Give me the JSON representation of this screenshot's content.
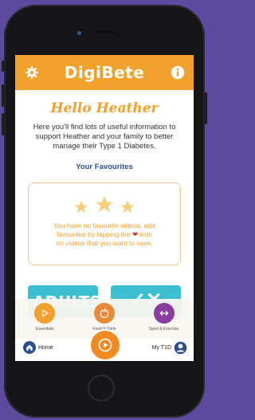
{
  "app": {
    "logo_text": "DigiBete",
    "brand_color": "#f2a12c",
    "accent_color": "#2d4f8e"
  },
  "header": {
    "settings_icon": "gear-icon",
    "info_icon": "info-icon"
  },
  "main": {
    "greeting": "Hello Heather",
    "intro": "Here you'll find lots of useful information to support Heather and your family to better manage their Type 1 Diabetes.",
    "favourites_title": "Your Favourites",
    "favourites_empty_line1": "You have no favourite videos, add",
    "favourites_empty_line2_before": "favourites by tapping the",
    "favourites_empty_line2_after": "icon",
    "favourites_empty_line3": "on videos that you want to save."
  },
  "tiles": [
    {
      "label": "ADULTS"
    },
    {
      "label": "✓✕"
    }
  ],
  "categories": [
    {
      "label": "Essentials",
      "color": "#f2a12c",
      "icon": "play-icon"
    },
    {
      "label": "Food & Drink",
      "color": "#e8893a",
      "icon": "apple-icon"
    },
    {
      "label": "Sport & Exercise",
      "color": "#8a3d9e",
      "icon": "arrows-icon"
    }
  ],
  "nav": {
    "home_label": "Home",
    "my_label": "My T1D"
  }
}
